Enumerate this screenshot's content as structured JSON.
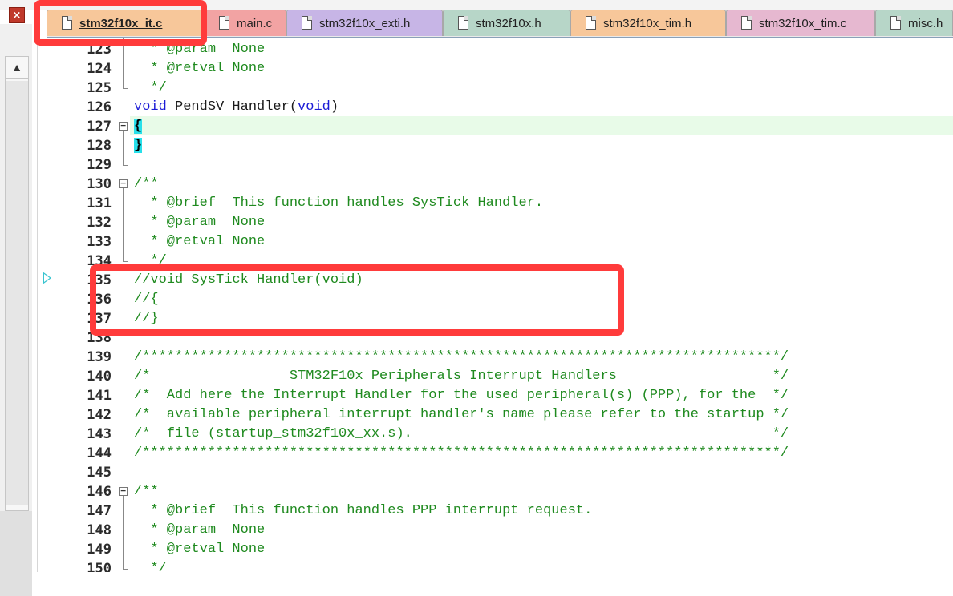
{
  "window": {
    "close_glyph": "×"
  },
  "tabs": [
    {
      "label": "stm32f10x_it.c",
      "color": "#f7c79a",
      "active": true
    },
    {
      "label": "main.c",
      "color": "#f2a3a3",
      "active": false
    },
    {
      "label": "stm32f10x_exti.h",
      "color": "#c7b5e6",
      "active": false
    },
    {
      "label": "stm32f10x.h",
      "color": "#b7d6c8",
      "active": false
    },
    {
      "label": "stm32f10x_tim.h",
      "color": "#f7c79a",
      "active": false
    },
    {
      "label": "stm32f10x_tim.c",
      "color": "#e6b8d0",
      "active": false
    },
    {
      "label": "misc.h",
      "color": "#b7d6c8",
      "active": false
    }
  ],
  "scrollbar": {
    "up_glyph": "▲"
  },
  "editor": {
    "lines": [
      {
        "num": "123",
        "text": "  * @param  None",
        "style": "cm"
      },
      {
        "num": "124",
        "text": "  * @retval None",
        "style": "cm"
      },
      {
        "num": "125",
        "text": "  */",
        "style": "cm"
      },
      {
        "num": "126",
        "text": "void PendSV_Handler(void)",
        "style": "code"
      },
      {
        "num": "127",
        "text": "{",
        "style": "brace"
      },
      {
        "num": "128",
        "text": "}",
        "style": "brace"
      },
      {
        "num": "129",
        "text": "",
        "style": "code"
      },
      {
        "num": "130",
        "text": "/**",
        "style": "cm"
      },
      {
        "num": "131",
        "text": "  * @brief  This function handles SysTick Handler.",
        "style": "cm"
      },
      {
        "num": "132",
        "text": "  * @param  None",
        "style": "cm"
      },
      {
        "num": "133",
        "text": "  * @retval None",
        "style": "cm"
      },
      {
        "num": "134",
        "text": "  */",
        "style": "cm"
      },
      {
        "num": "135",
        "text": "//void SysTick_Handler(void)",
        "style": "cm"
      },
      {
        "num": "136",
        "text": "//{",
        "style": "cm"
      },
      {
        "num": "137",
        "text": "//}",
        "style": "cm"
      },
      {
        "num": "138",
        "text": "",
        "style": "code"
      },
      {
        "num": "139",
        "text": "/******************************************************************************/",
        "style": "cm"
      },
      {
        "num": "140",
        "text": "/*                 STM32F10x Peripherals Interrupt Handlers                   */",
        "style": "cm"
      },
      {
        "num": "141",
        "text": "/*  Add here the Interrupt Handler for the used peripheral(s) (PPP), for the  */",
        "style": "cm"
      },
      {
        "num": "142",
        "text": "/*  available peripheral interrupt handler's name please refer to the startup */",
        "style": "cm"
      },
      {
        "num": "143",
        "text": "/*  file (startup_stm32f10x_xx.s).                                            */",
        "style": "cm"
      },
      {
        "num": "144",
        "text": "/******************************************************************************/",
        "style": "cm"
      },
      {
        "num": "145",
        "text": "",
        "style": "code"
      },
      {
        "num": "146",
        "text": "/**",
        "style": "cm"
      },
      {
        "num": "147",
        "text": "  * @brief  This function handles PPP interrupt request.",
        "style": "cm"
      },
      {
        "num": "148",
        "text": "  * @param  None",
        "style": "cm"
      },
      {
        "num": "149",
        "text": "  * @retval None",
        "style": "cm"
      },
      {
        "num": "150",
        "text": "  */",
        "style": "cm"
      }
    ]
  },
  "annotations": {
    "highlight_color": "#ff3b3b"
  }
}
